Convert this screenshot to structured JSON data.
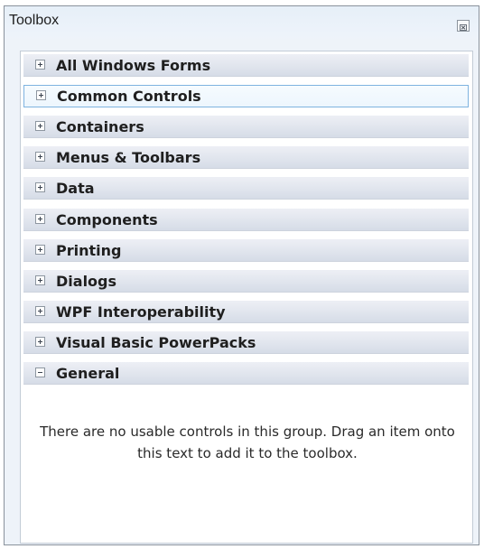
{
  "toolbox": {
    "title": "Toolbox",
    "close_icon": "close-icon",
    "groups": [
      {
        "label": "All Windows Forms",
        "expanded": false,
        "selected": false
      },
      {
        "label": "Common Controls",
        "expanded": false,
        "selected": true
      },
      {
        "label": "Containers",
        "expanded": false,
        "selected": false
      },
      {
        "label": "Menus & Toolbars",
        "expanded": false,
        "selected": false
      },
      {
        "label": "Data",
        "expanded": false,
        "selected": false
      },
      {
        "label": "Components",
        "expanded": false,
        "selected": false
      },
      {
        "label": "Printing",
        "expanded": false,
        "selected": false
      },
      {
        "label": "Dialogs",
        "expanded": false,
        "selected": false
      },
      {
        "label": "WPF Interoperability",
        "expanded": false,
        "selected": false
      },
      {
        "label": "Visual Basic PowerPacks",
        "expanded": false,
        "selected": false
      },
      {
        "label": "General",
        "expanded": true,
        "selected": false
      }
    ],
    "empty_message": "There are no usable controls in this group. Drag an item onto this text to add it to the toolbox."
  },
  "colors": {
    "selection_border": "#7fb3e0",
    "window_border": "#8a929c",
    "header_background": "#dde2ea"
  }
}
